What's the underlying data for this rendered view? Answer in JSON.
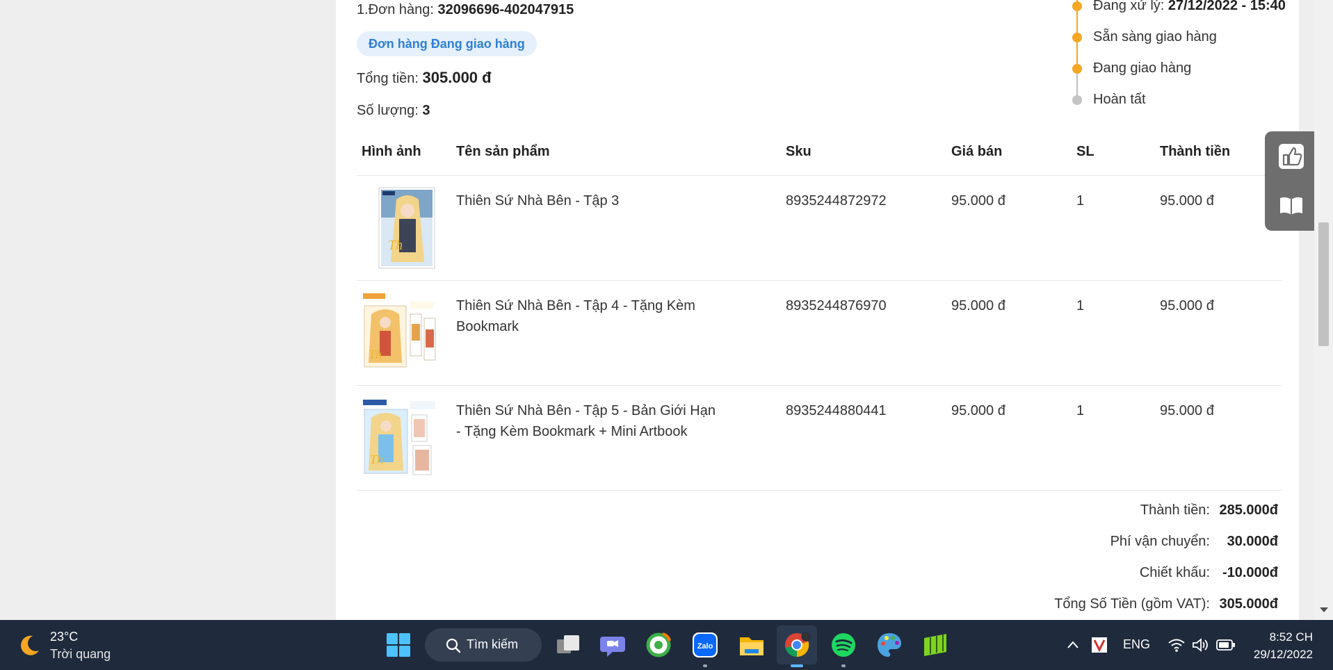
{
  "order": {
    "number_label": "1.Đơn hàng:",
    "number_value": "32096696-402047915",
    "status_badge": "Đơn hàng Đang giao hàng",
    "total_label": "Tổng tiền:",
    "total_value": "305.000 đ",
    "qty_label": "Số lượng:",
    "qty_value": "3"
  },
  "timeline": {
    "steps": [
      {
        "label": "Đang xử lý:",
        "value": "27/12/2022 - 15:40",
        "done": true
      },
      {
        "label": "Sẵn sàng giao hàng",
        "value": "",
        "done": true
      },
      {
        "label": "Đang giao hàng",
        "value": "",
        "done": true
      },
      {
        "label": "Hoàn tất",
        "value": "",
        "done": false
      }
    ],
    "colors": {
      "done": "#f5a623",
      "pending": "#c4c4c4"
    }
  },
  "table": {
    "headers": [
      "Hình ảnh",
      "Tên sản phẩm",
      "Sku",
      "Giá bán",
      "SL",
      "Thành tiền"
    ],
    "rows": [
      {
        "name": "Thiên Sứ Nhà Bên - Tập 3",
        "sku": "8935244872972",
        "price": "95.000 đ",
        "qty": "1",
        "subtotal": "95.000 đ"
      },
      {
        "name": "Thiên Sứ Nhà Bên - Tập 4 - Tặng Kèm Bookmark",
        "sku": "8935244876970",
        "price": "95.000 đ",
        "qty": "1",
        "subtotal": "95.000 đ"
      },
      {
        "name": "Thiên Sứ Nhà Bên - Tập 5 - Bản Giới Hạn - Tặng Kèm Bookmark + Mini Artbook",
        "sku": "8935244880441",
        "price": "95.000 đ",
        "qty": "1",
        "subtotal": "95.000 đ"
      }
    ]
  },
  "totals": {
    "subtotal_label": "Thành tiền:",
    "subtotal_value": "285.000đ",
    "shipping_label": "Phí vận chuyển:",
    "shipping_value": "30.000đ",
    "discount_label": "Chiết khấu:",
    "discount_value": "-10.000đ",
    "grand_label": "Tổng Số Tiền (gồm VAT):",
    "grand_value": "305.000đ"
  },
  "side_widget": {
    "icons": [
      "thumbs-up-icon",
      "open-book-icon"
    ]
  },
  "taskbar": {
    "weather_temp": "23°C",
    "weather_cond": "Trời quang",
    "search_label": "Tìm kiếm",
    "apps": [
      "windows-start-icon",
      "search",
      "task-view-icon",
      "teams-chat-icon",
      "coccoc-browser-icon",
      "zalo-icon",
      "file-explorer-icon",
      "chrome-icon",
      "spotify-icon",
      "paint-icon",
      "green-app-icon"
    ],
    "zalo_text": "Zalo",
    "lang": "ENG",
    "time": "8:52 CH",
    "date": "29/12/2022"
  },
  "colors": {
    "accent": "#2f80d6",
    "badge_bg": "#e5f0fc",
    "taskbar": "#1f2a3c"
  }
}
